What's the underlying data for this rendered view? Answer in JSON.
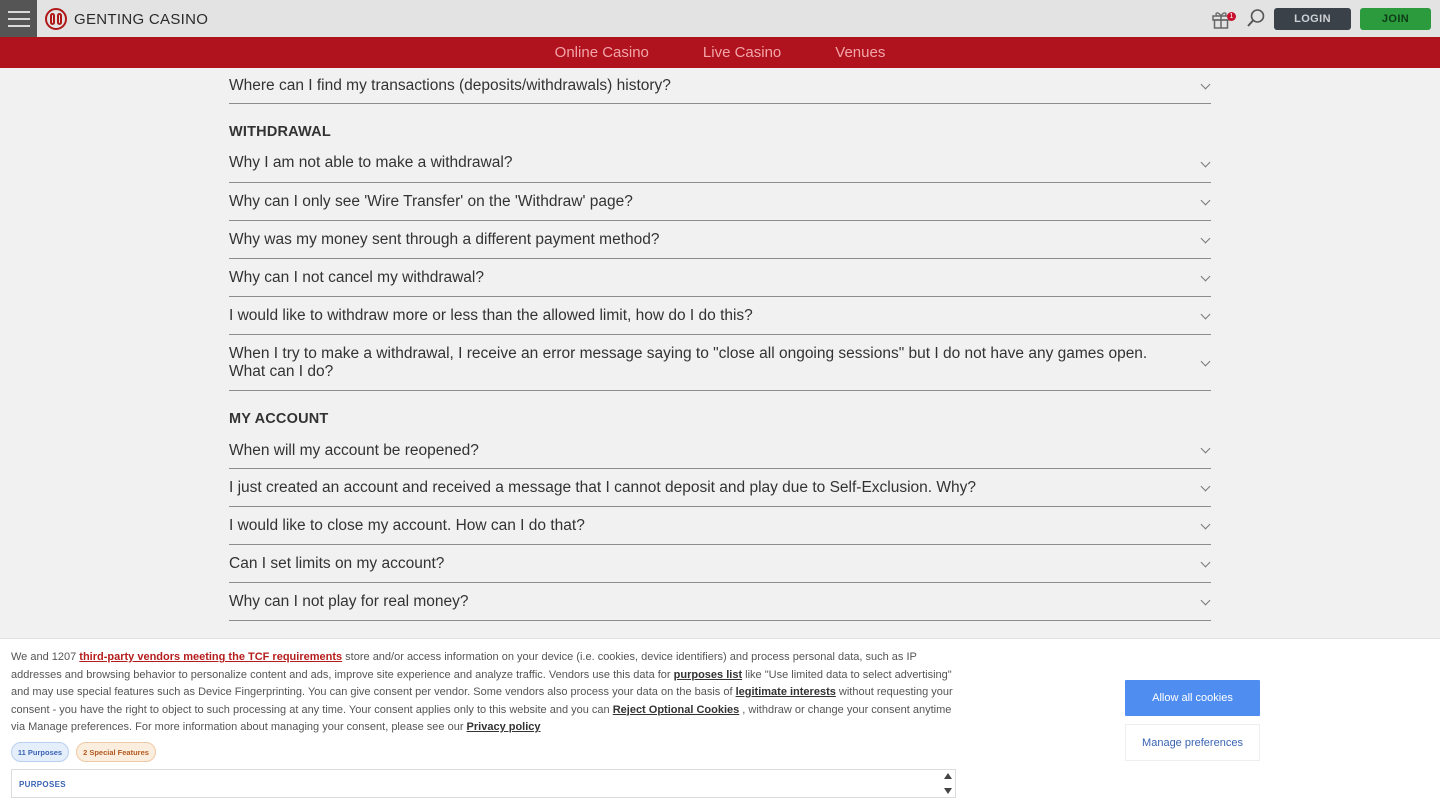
{
  "header": {
    "brand": "GENTING CASINO",
    "gift_count": "1",
    "login_label": "LOGIN",
    "join_label": "JOIN"
  },
  "nav": [
    "Online Casino",
    "Live Casino",
    "Venues"
  ],
  "faq": {
    "top_question": "Where can I find my transactions (deposits/withdrawals) history?",
    "withdrawal_title": "WITHDRAWAL",
    "withdrawal_questions": [
      "Why I am not able to make a withdrawal?",
      "Why can I only see 'Wire Transfer' on the 'Withdraw' page?",
      "Why was my money sent through a different payment method?",
      "Why can I not cancel my withdrawal?",
      "I would like to withdraw more or less than the allowed limit, how do I do this?",
      "When I try to make a withdrawal, I receive an error message saying to \"close all ongoing sessions\" but I do not have any games open. What can I do?"
    ],
    "account_title": "MY ACCOUNT",
    "account_questions": [
      "When will my account be reopened?",
      "I just created an account and received a message that I cannot deposit and play due to Self-Exclusion. Why?",
      "I would like to close my account. How can I do that?",
      "Can I set limits on my account?",
      "Why can I not play for real money?"
    ]
  },
  "consent": {
    "t1": "We and 1207 ",
    "link_vendors": "third-party vendors meeting the TCF requirements",
    "t2": " store and/or access information on your device (i.e. cookies, device identifiers) and process personal data, such as IP addresses and browsing behavior to personalize content and ads, improve site experience and analyze traffic. Vendors use this data for ",
    "link_purposes": "purposes list",
    "t3": "  like \"Use limited data to select advertising\" and may use special features such as Device Fingerprinting. You can give consent per vendor. Some vendors also process your data on the basis of ",
    "link_legit": "legitimate interests",
    "t4": "  without requesting your consent - you have the right to object to such processing at any time. Your consent applies only to this website and you can ",
    "link_reject": "Reject Optional Cookies",
    "t5": " , withdraw or change your consent anytime via Manage preferences. For more information about managing your consent, please see our ",
    "link_privacy": "Privacy policy",
    "pill_purposes": "11 Purposes",
    "pill_special": "2 Special Features",
    "purposes_label": "PURPOSES",
    "allow_label": "Allow all cookies",
    "manage_label": "Manage preferences"
  }
}
